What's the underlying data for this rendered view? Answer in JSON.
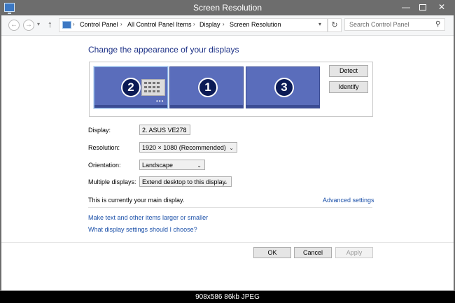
{
  "window": {
    "title": "Screen Resolution",
    "min_glyph": "—",
    "close_glyph": "✕"
  },
  "nav": {
    "back_glyph": "←",
    "forward_glyph": "→",
    "recent_glyph": "▾",
    "up_glyph": "↑",
    "breadcrumbs": [
      "Control Panel",
      "All Control Panel Items",
      "Display",
      "Screen Resolution"
    ],
    "separator": "›",
    "address_dropdown_glyph": "▾",
    "refresh_glyph": "↻",
    "search_placeholder": "Search Control Panel",
    "search_glyph": "⚲"
  },
  "main": {
    "heading": "Change the appearance of your displays",
    "monitors": [
      {
        "number": "2",
        "selected": true
      },
      {
        "number": "1",
        "selected": false
      },
      {
        "number": "3",
        "selected": false
      }
    ],
    "monitor_dots": "•••",
    "detect_label": "Detect",
    "identify_label": "Identify",
    "fields": {
      "display": {
        "label": "Display:",
        "value": "2. ASUS VE278"
      },
      "resolution": {
        "label": "Resolution:",
        "value": "1920 × 1080 (Recommended)"
      },
      "orientation": {
        "label": "Orientation:",
        "value": "Landscape"
      },
      "multiple": {
        "label": "Multiple displays:",
        "value": "Extend desktop to this display"
      }
    },
    "combo_arrow": "⌄",
    "main_display_message": "This is currently your main display.",
    "advanced_settings_link": "Advanced settings",
    "links": [
      "Make text and other items larger or smaller",
      "What display settings should I choose?"
    ]
  },
  "footer": {
    "ok_label": "OK",
    "cancel_label": "Cancel",
    "apply_label": "Apply"
  },
  "statusbar": {
    "text": "908x586  86kb  JPEG"
  },
  "colors": {
    "monitor_fill": "#5a6dbb",
    "link": "#1a4fa8",
    "heading": "#1e3287",
    "titlebar": "#6d6d6d"
  }
}
